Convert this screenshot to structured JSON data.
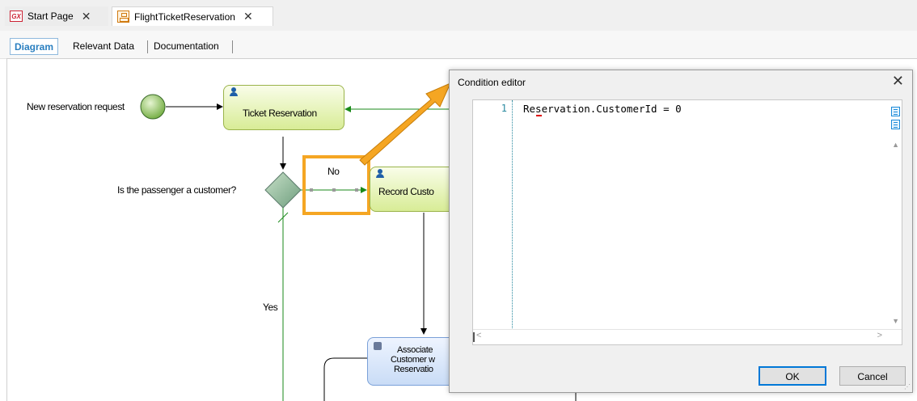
{
  "tabs": [
    {
      "label": "Start Page",
      "icon": "genexus-logo-icon",
      "close": "✕",
      "active": false
    },
    {
      "label": "FlightTicketReservation",
      "icon": "process-diagram-icon",
      "close": "✕",
      "active": true
    }
  ],
  "subtabs": [
    {
      "label": "Diagram",
      "active": true
    },
    {
      "label": "Relevant Data",
      "active": false
    },
    {
      "label": "Documentation",
      "active": false
    }
  ],
  "diagram": {
    "start_event_label": "New reservation request",
    "task_ticket_reservation": "Ticket Reservation",
    "gateway_label": "Is the passenger a customer?",
    "flow_no_label": "No",
    "flow_yes_label": "Yes",
    "task_record_customer": "Record Custo",
    "task_associate_line1": "Associate",
    "task_associate_line2": "Customer w",
    "task_associate_line3": "Reservatio"
  },
  "dialog": {
    "title": "Condition editor",
    "close": "✕",
    "line_number": "1",
    "code": "Reservation.CustomerId = 0",
    "ok_label": "OK",
    "cancel_label": "Cancel"
  },
  "colors": {
    "highlight": "#f5a623",
    "accent": "#0078d7",
    "task_green": "#d8ec96",
    "task_blue": "#c9dcf6"
  }
}
